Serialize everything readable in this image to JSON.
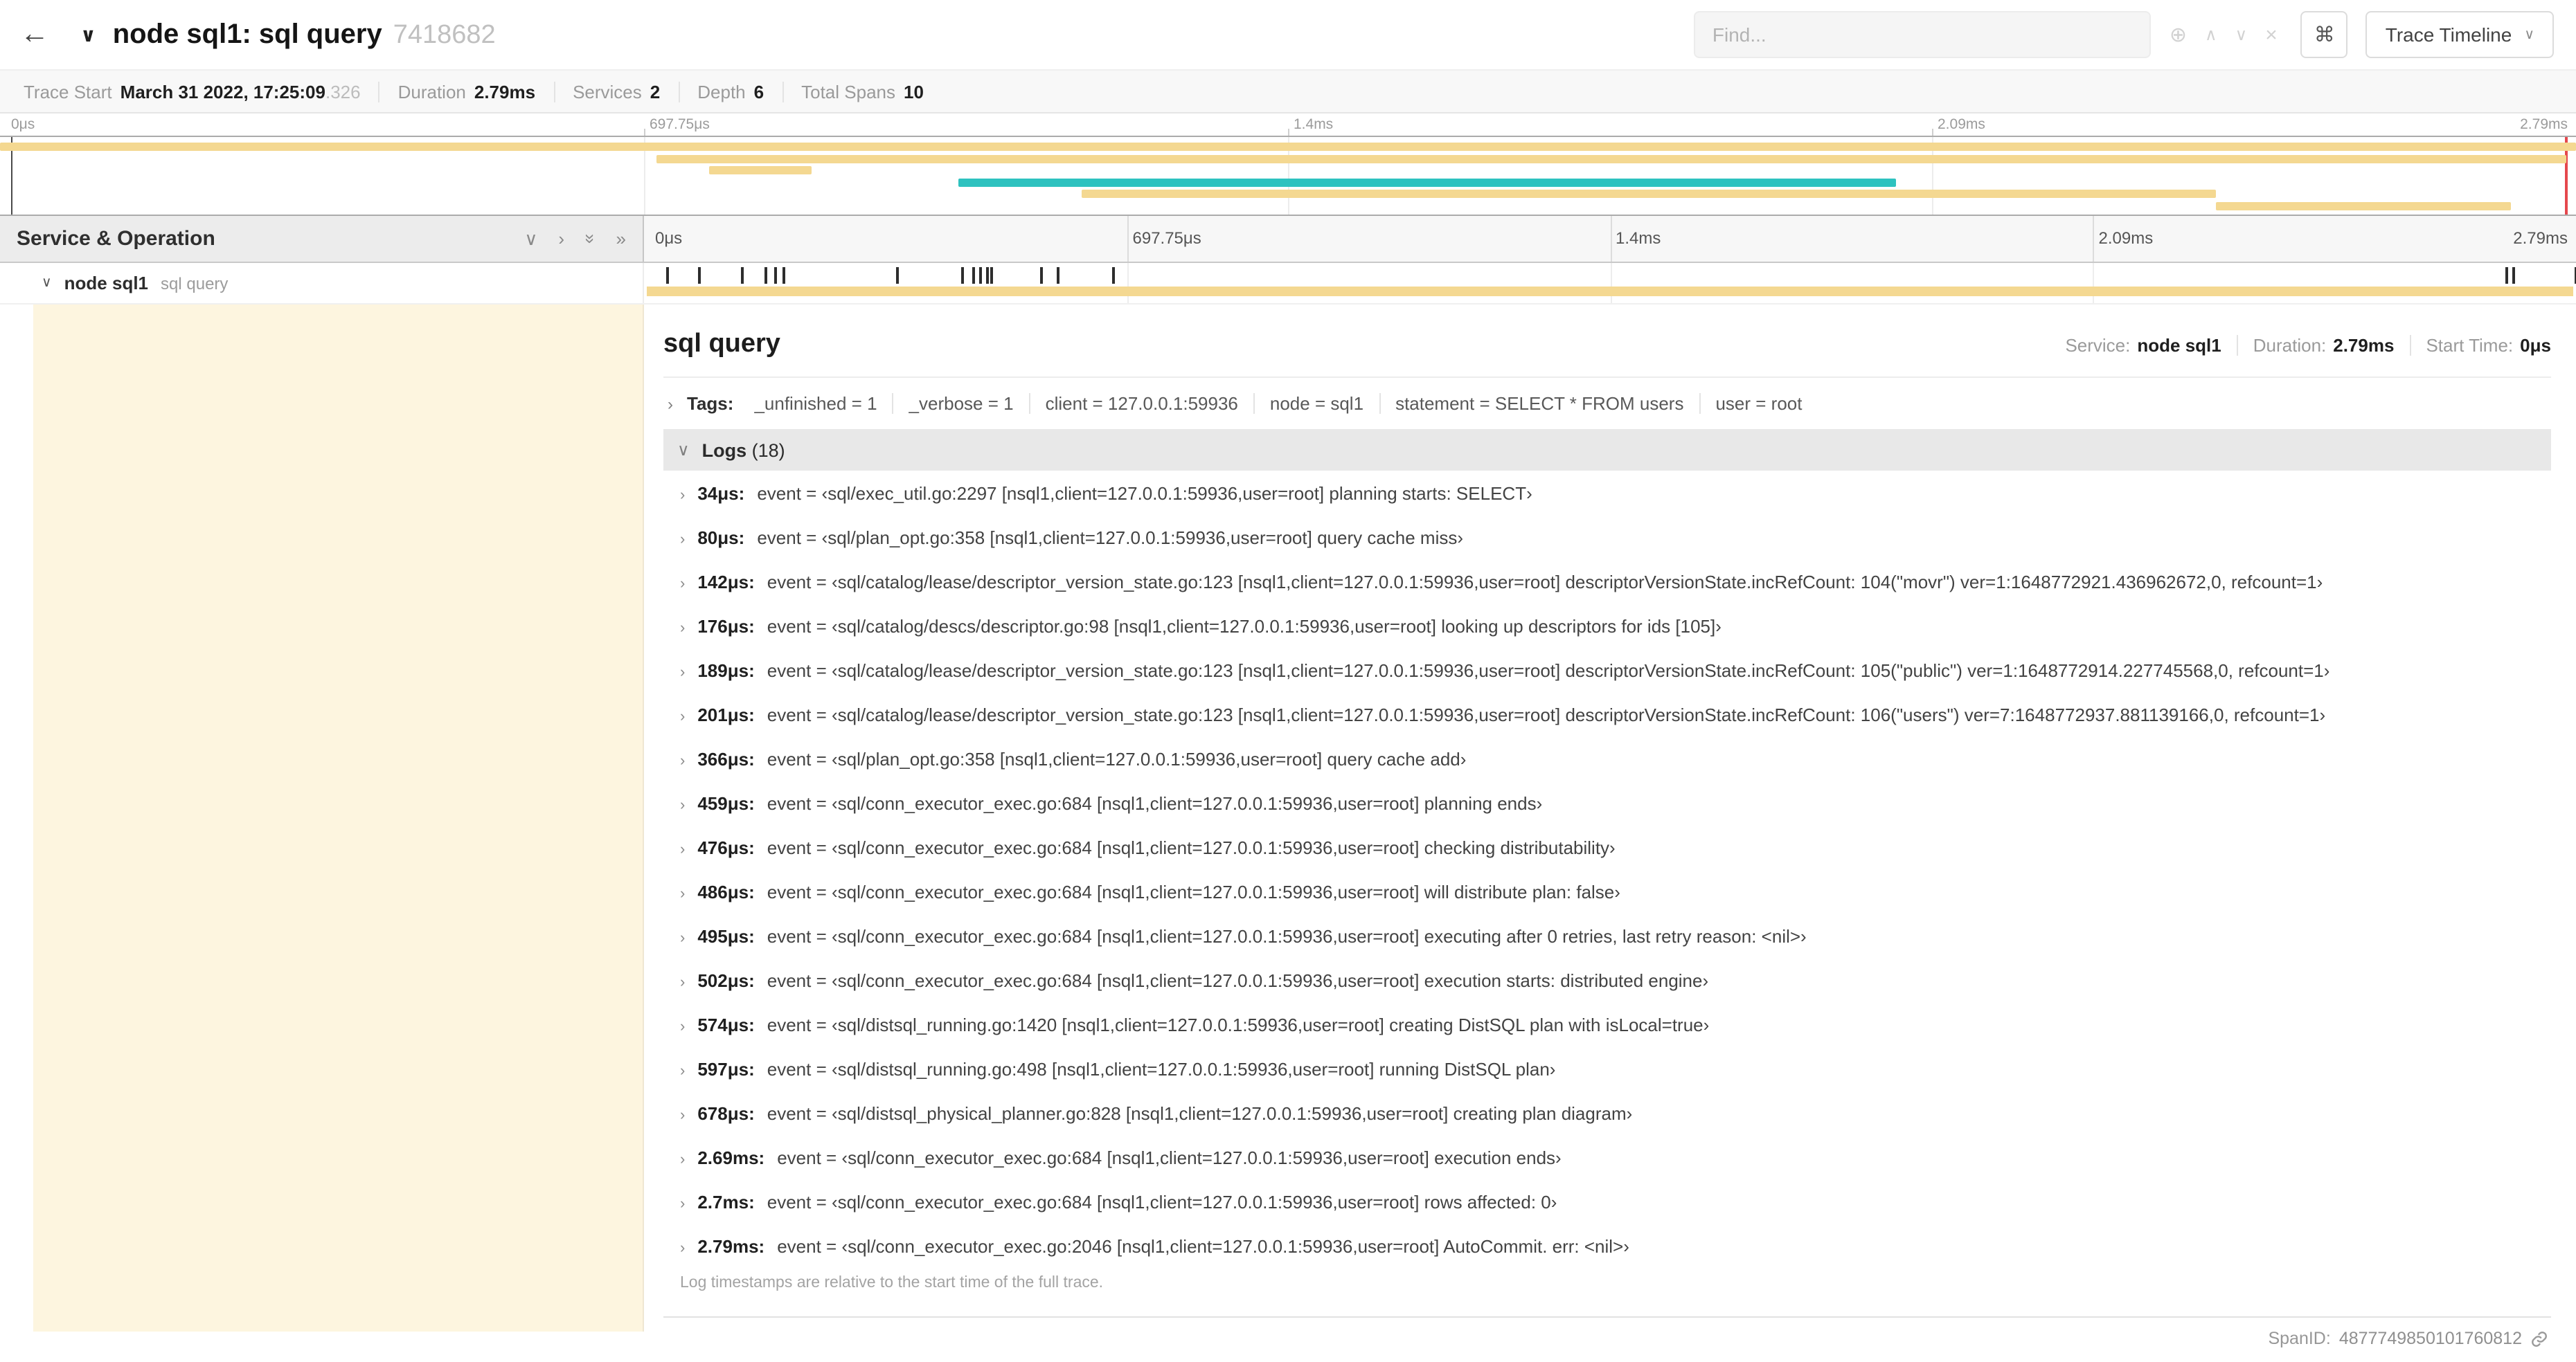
{
  "colors": {
    "tan": "#f4d891",
    "teal": "#2ec2bf",
    "cream": "#fdf5df",
    "tick": "#2d2d2d",
    "marker_red": "#e5484d"
  },
  "header": {
    "back_icon": "←",
    "collapse_icon": "∨",
    "title": "node sql1: sql query",
    "trace_id": "7418682",
    "find": {
      "placeholder": "Find..."
    },
    "result_icons": {
      "focus": "⊕",
      "prev": "∧",
      "next": "∨",
      "clear": "×"
    },
    "keyboard_button": "⌘",
    "view_button": {
      "label": "Trace Timeline",
      "caret": "∨"
    }
  },
  "summary": {
    "items": [
      {
        "label": "Trace Start",
        "value": "March 31 2022, 17:25:09",
        "extra": ".326"
      },
      {
        "label": "Duration",
        "value": "2.79ms"
      },
      {
        "label": "Services",
        "value": "2"
      },
      {
        "label": "Depth",
        "value": "6"
      },
      {
        "label": "Total Spans",
        "value": "10"
      }
    ]
  },
  "axis": {
    "ticks": [
      {
        "label": "0μs",
        "pct": 0
      },
      {
        "label": "697.75μs",
        "pct": 25
      },
      {
        "label": "1.4ms",
        "pct": 50
      },
      {
        "label": "2.09ms",
        "pct": 75
      },
      {
        "label": "2.79ms",
        "pct": 100,
        "align": "right"
      }
    ]
  },
  "minimap": {
    "rows": [
      {
        "start": 0,
        "end": 100,
        "color": "tan"
      },
      {
        "start": 25.5,
        "end": 99.6,
        "color": "tan"
      },
      {
        "start": 27.5,
        "end": 31.5,
        "color": "tan"
      },
      {
        "start": 37.2,
        "end": 73.6,
        "color": "teal"
      },
      {
        "start": 42,
        "end": 86,
        "color": "tan"
      },
      {
        "start": 86,
        "end": 97.5,
        "color": "tan"
      }
    ]
  },
  "grid": {
    "left_header": "Service & Operation",
    "icons": {
      "collapse_one": "∨",
      "expand_one": "›",
      "collapse_all": "»",
      "expand_all": "»"
    }
  },
  "span_row": {
    "chevron": "∨",
    "service": "node sql1",
    "operation": "sql query",
    "duration_us": 2790,
    "log_times_us": [
      34,
      80,
      142,
      176,
      189,
      201,
      366,
      459,
      476,
      486,
      495,
      502,
      574,
      597,
      678,
      2690,
      2700,
      2790
    ]
  },
  "detail": {
    "title": "sql query",
    "meta": [
      {
        "label": "Service:",
        "value": "node sql1"
      },
      {
        "label": "Duration:",
        "value": "2.79ms"
      },
      {
        "label": "Start Time:",
        "value": "0μs"
      }
    ],
    "tags": {
      "caret": "›",
      "label": "Tags:",
      "items": [
        "_unfinished = 1",
        "_verbose = 1",
        "client = 127.0.0.1:59936",
        "node = sql1",
        "statement = SELECT * FROM users",
        "user = root"
      ]
    },
    "logs": {
      "caret": "∨",
      "label": "Logs",
      "count": "(18)",
      "row_caret": "›",
      "entries": [
        {
          "time": "34μs:",
          "text": "event = ‹sql/exec_util.go:2297 [nsql1,client=127.0.0.1:59936,user=root] planning starts: SELECT›"
        },
        {
          "time": "80μs:",
          "text": "event = ‹sql/plan_opt.go:358 [nsql1,client=127.0.0.1:59936,user=root] query cache miss›"
        },
        {
          "time": "142μs:",
          "text": "event = ‹sql/catalog/lease/descriptor_version_state.go:123 [nsql1,client=127.0.0.1:59936,user=root] descriptorVersionState.incRefCount: 104(\"movr\") ver=1:1648772921.436962672,0, refcount=1›"
        },
        {
          "time": "176μs:",
          "text": "event = ‹sql/catalog/descs/descriptor.go:98 [nsql1,client=127.0.0.1:59936,user=root] looking up descriptors for ids [105]›"
        },
        {
          "time": "189μs:",
          "text": "event = ‹sql/catalog/lease/descriptor_version_state.go:123 [nsql1,client=127.0.0.1:59936,user=root] descriptorVersionState.incRefCount: 105(\"public\") ver=1:1648772914.227745568,0, refcount=1›"
        },
        {
          "time": "201μs:",
          "text": "event = ‹sql/catalog/lease/descriptor_version_state.go:123 [nsql1,client=127.0.0.1:59936,user=root] descriptorVersionState.incRefCount: 106(\"users\") ver=7:1648772937.881139166,0, refcount=1›"
        },
        {
          "time": "366μs:",
          "text": "event = ‹sql/plan_opt.go:358 [nsql1,client=127.0.0.1:59936,user=root] query cache add›"
        },
        {
          "time": "459μs:",
          "text": "event = ‹sql/conn_executor_exec.go:684 [nsql1,client=127.0.0.1:59936,user=root] planning ends›"
        },
        {
          "time": "476μs:",
          "text": "event = ‹sql/conn_executor_exec.go:684 [nsql1,client=127.0.0.1:59936,user=root] checking distributability›"
        },
        {
          "time": "486μs:",
          "text": "event = ‹sql/conn_executor_exec.go:684 [nsql1,client=127.0.0.1:59936,user=root] will distribute plan: false›"
        },
        {
          "time": "495μs:",
          "text": "event = ‹sql/conn_executor_exec.go:684 [nsql1,client=127.0.0.1:59936,user=root] executing after 0 retries, last retry reason: <nil>›"
        },
        {
          "time": "502μs:",
          "text": "event = ‹sql/conn_executor_exec.go:684 [nsql1,client=127.0.0.1:59936,user=root] execution starts: distributed engine›"
        },
        {
          "time": "574μs:",
          "text": "event = ‹sql/distsql_running.go:1420 [nsql1,client=127.0.0.1:59936,user=root] creating DistSQL plan with isLocal=true›"
        },
        {
          "time": "597μs:",
          "text": "event = ‹sql/distsql_running.go:498 [nsql1,client=127.0.0.1:59936,user=root] running DistSQL plan›"
        },
        {
          "time": "678μs:",
          "text": "event = ‹sql/distsql_physical_planner.go:828 [nsql1,client=127.0.0.1:59936,user=root] creating plan diagram›"
        },
        {
          "time": "2.69ms:",
          "text": "event = ‹sql/conn_executor_exec.go:684 [nsql1,client=127.0.0.1:59936,user=root] execution ends›"
        },
        {
          "time": "2.7ms:",
          "text": "event = ‹sql/conn_executor_exec.go:684 [nsql1,client=127.0.0.1:59936,user=root] rows affected: 0›"
        },
        {
          "time": "2.79ms:",
          "text": "event = ‹sql/conn_executor_exec.go:2046 [nsql1,client=127.0.0.1:59936,user=root] AutoCommit. err: <nil>›"
        }
      ],
      "note": "Log timestamps are relative to the start time of the full trace."
    },
    "footer": {
      "label": "SpanID:",
      "value": "4877749850101760812"
    }
  }
}
